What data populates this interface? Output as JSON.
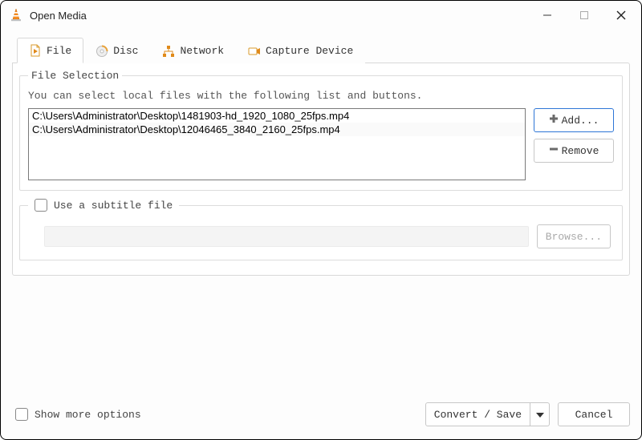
{
  "window": {
    "title": "Open Media"
  },
  "tabs": {
    "file": "File",
    "disc": "Disc",
    "network": "Network",
    "capture": "Capture Device"
  },
  "fileSelection": {
    "legend": "File Selection",
    "hint": "You can select local files with the following list and buttons.",
    "files": [
      "C:\\Users\\Administrator\\Desktop\\1481903-hd_1920_1080_25fps.mp4",
      "C:\\Users\\Administrator\\Desktop\\12046465_3840_2160_25fps.mp4"
    ],
    "add": "Add...",
    "remove": "Remove"
  },
  "subtitle": {
    "label": "Use a subtitle file",
    "browse": "Browse..."
  },
  "options": {
    "showMore": "Show more options"
  },
  "footer": {
    "convert": "Convert / Save",
    "cancel": "Cancel"
  }
}
